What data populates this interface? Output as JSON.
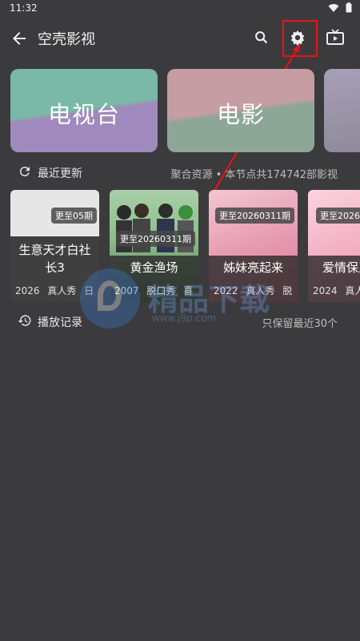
{
  "status": {
    "time": "11:32"
  },
  "appbar": {
    "title": "空壳影视"
  },
  "categories": [
    {
      "label": "电视台"
    },
    {
      "label": "电影"
    },
    {
      "label": ""
    }
  ],
  "recent": {
    "title": "最近更新",
    "info": "聚合资源 • 本节点共174742部影视"
  },
  "cards": [
    {
      "title": "生意天才白社长3",
      "badge": "更至05期",
      "year": "2026",
      "tags": [
        "真人秀",
        "日"
      ]
    },
    {
      "title": "黄金渔场",
      "badge": "更至20260311期",
      "year": "2007",
      "tags": [
        "脱口秀",
        "喜"
      ]
    },
    {
      "title": "姊妹亮起来",
      "badge": "更至20260311期",
      "year": "2022",
      "tags": [
        "真人秀",
        "脱"
      ]
    },
    {
      "title": "爱情保卫",
      "badge": "更至2026",
      "year": "2024",
      "tags": [
        "真人"
      ]
    }
  ],
  "history": {
    "title": "播放记录",
    "info": "只保留最近30个"
  },
  "watermark": {
    "text": "精品下载",
    "url": "www.j9p.com"
  },
  "colors": {
    "background": "#3b3b3d",
    "highlight": "#ee1111"
  }
}
